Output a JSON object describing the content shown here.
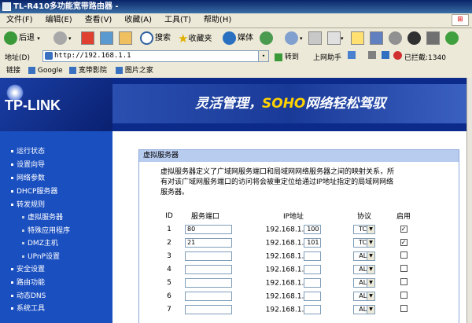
{
  "window": {
    "title": "TL-R410多功能宽带路由器 -"
  },
  "menu": [
    "文件(F)",
    "编辑(E)",
    "查看(V)",
    "收藏(A)",
    "工具(T)",
    "帮助(H)"
  ],
  "toolbar": {
    "back": "后退",
    "search": "搜索",
    "favorites": "收藏夹",
    "media": "媒体"
  },
  "address": {
    "label": "地址(D)",
    "url": "http://192.168.1.1",
    "go": "转到",
    "online_help": "上网助手",
    "blocked": "已拦截:1340"
  },
  "links": {
    "label": "链接",
    "items": [
      "Google",
      "宽带影院",
      "图片之家"
    ]
  },
  "banner": {
    "logo": "TP-LINK",
    "slogan_pre": "灵活管理，",
    "slogan_soho": "SOHO",
    "slogan_post": "网络轻松驾驭"
  },
  "nav": [
    {
      "label": "运行状态",
      "sub": false
    },
    {
      "label": "设置向导",
      "sub": false
    },
    {
      "label": "网络参数",
      "sub": false
    },
    {
      "label": "DHCP服务器",
      "sub": false
    },
    {
      "label": "转发规则",
      "sub": false
    },
    {
      "label": "虚拟服务器",
      "sub": true
    },
    {
      "label": "特殊应用程序",
      "sub": true
    },
    {
      "label": "DMZ主机",
      "sub": true
    },
    {
      "label": "UPnP设置",
      "sub": true
    },
    {
      "label": "安全设置",
      "sub": false
    },
    {
      "label": "路由功能",
      "sub": false
    },
    {
      "label": "动态DNS",
      "sub": false
    },
    {
      "label": "系统工具",
      "sub": false
    }
  ],
  "panel": {
    "title": "虚拟服务器",
    "desc1": "虚拟服务器定义了广域网服务端口和局域网网络服务器之间的映射关系，所",
    "desc2": "有对该广域网服务端口的访问将会被重定位给通过IP地址指定的局域网网络",
    "desc3": "服务器。",
    "headers": {
      "id": "ID",
      "port": "服务端口",
      "ip": "IP地址",
      "proto": "协议",
      "enable": "启用"
    },
    "ip_prefix": "192.168.1.",
    "rows": [
      {
        "id": "1",
        "port": "80",
        "ip_last": "100",
        "proto": "TCP",
        "enabled": "✓"
      },
      {
        "id": "2",
        "port": "21",
        "ip_last": "101",
        "proto": "TCP",
        "enabled": "✓"
      },
      {
        "id": "3",
        "port": "",
        "ip_last": "",
        "proto": "ALL",
        "enabled": ""
      },
      {
        "id": "4",
        "port": "",
        "ip_last": "",
        "proto": "ALL",
        "enabled": ""
      },
      {
        "id": "5",
        "port": "",
        "ip_last": "",
        "proto": "ALL",
        "enabled": ""
      },
      {
        "id": "6",
        "port": "",
        "ip_last": "",
        "proto": "ALL",
        "enabled": ""
      },
      {
        "id": "7",
        "port": "",
        "ip_last": "",
        "proto": "ALL",
        "enabled": ""
      }
    ]
  }
}
